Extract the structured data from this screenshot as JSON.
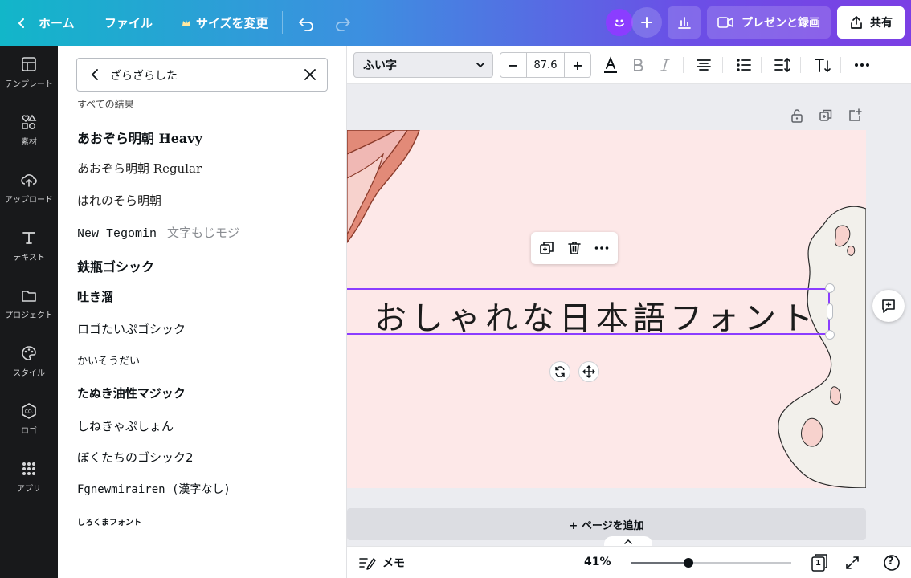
{
  "topbar": {
    "home_label": "ホーム",
    "file_label": "ファイル",
    "resize_label": "サイズを変更",
    "present_label": "プレゼンと録画",
    "share_label": "共有"
  },
  "rail": {
    "items": [
      {
        "label": "テンプレート",
        "icon": "template-icon"
      },
      {
        "label": "素材",
        "icon": "elements-icon"
      },
      {
        "label": "アップロード",
        "icon": "upload-icon"
      },
      {
        "label": "テキスト",
        "icon": "text-icon"
      },
      {
        "label": "プロジェクト",
        "icon": "folder-icon"
      },
      {
        "label": "スタイル",
        "icon": "palette-icon"
      },
      {
        "label": "ロゴ",
        "icon": "logo-icon"
      },
      {
        "label": "アプリ",
        "icon": "apps-icon"
      }
    ]
  },
  "panel": {
    "search_value": "ざらざらした",
    "results_label": "すべての結果",
    "fonts": [
      "あおぞら明朝 Heavy",
      "あおぞら明朝 Regular",
      "はれのそら明朝",
      "New Tegomin",
      "鉄瓶ゴシック",
      "吐き溜",
      "ロゴたいぷゴシック",
      "かいそうだい",
      "たぬき油性マジック",
      "しねきゃぷしょん",
      "ぼくたちのゴシック2",
      "Fgnewmirairen (漢字なし)",
      "しろくまフォント"
    ],
    "tegomin_sample": "文字もじモジ"
  },
  "toolbar": {
    "font_name": "ふい字",
    "font_size": "87.6",
    "minus": "−",
    "plus": "+"
  },
  "canvas": {
    "heading": "おしゃれな日本語フォント",
    "add_page_label": "+ ページを追加"
  },
  "bottombar": {
    "memo_label": "メモ",
    "zoom_label": "41%",
    "zoom_value": 41,
    "page_count": "1",
    "help": "?"
  },
  "colors": {
    "accent": "#8b3dff",
    "canvas_bg": "#fde8e8",
    "shape_fill": "#f0b8b4",
    "shape_stroke": "#c8533f"
  }
}
